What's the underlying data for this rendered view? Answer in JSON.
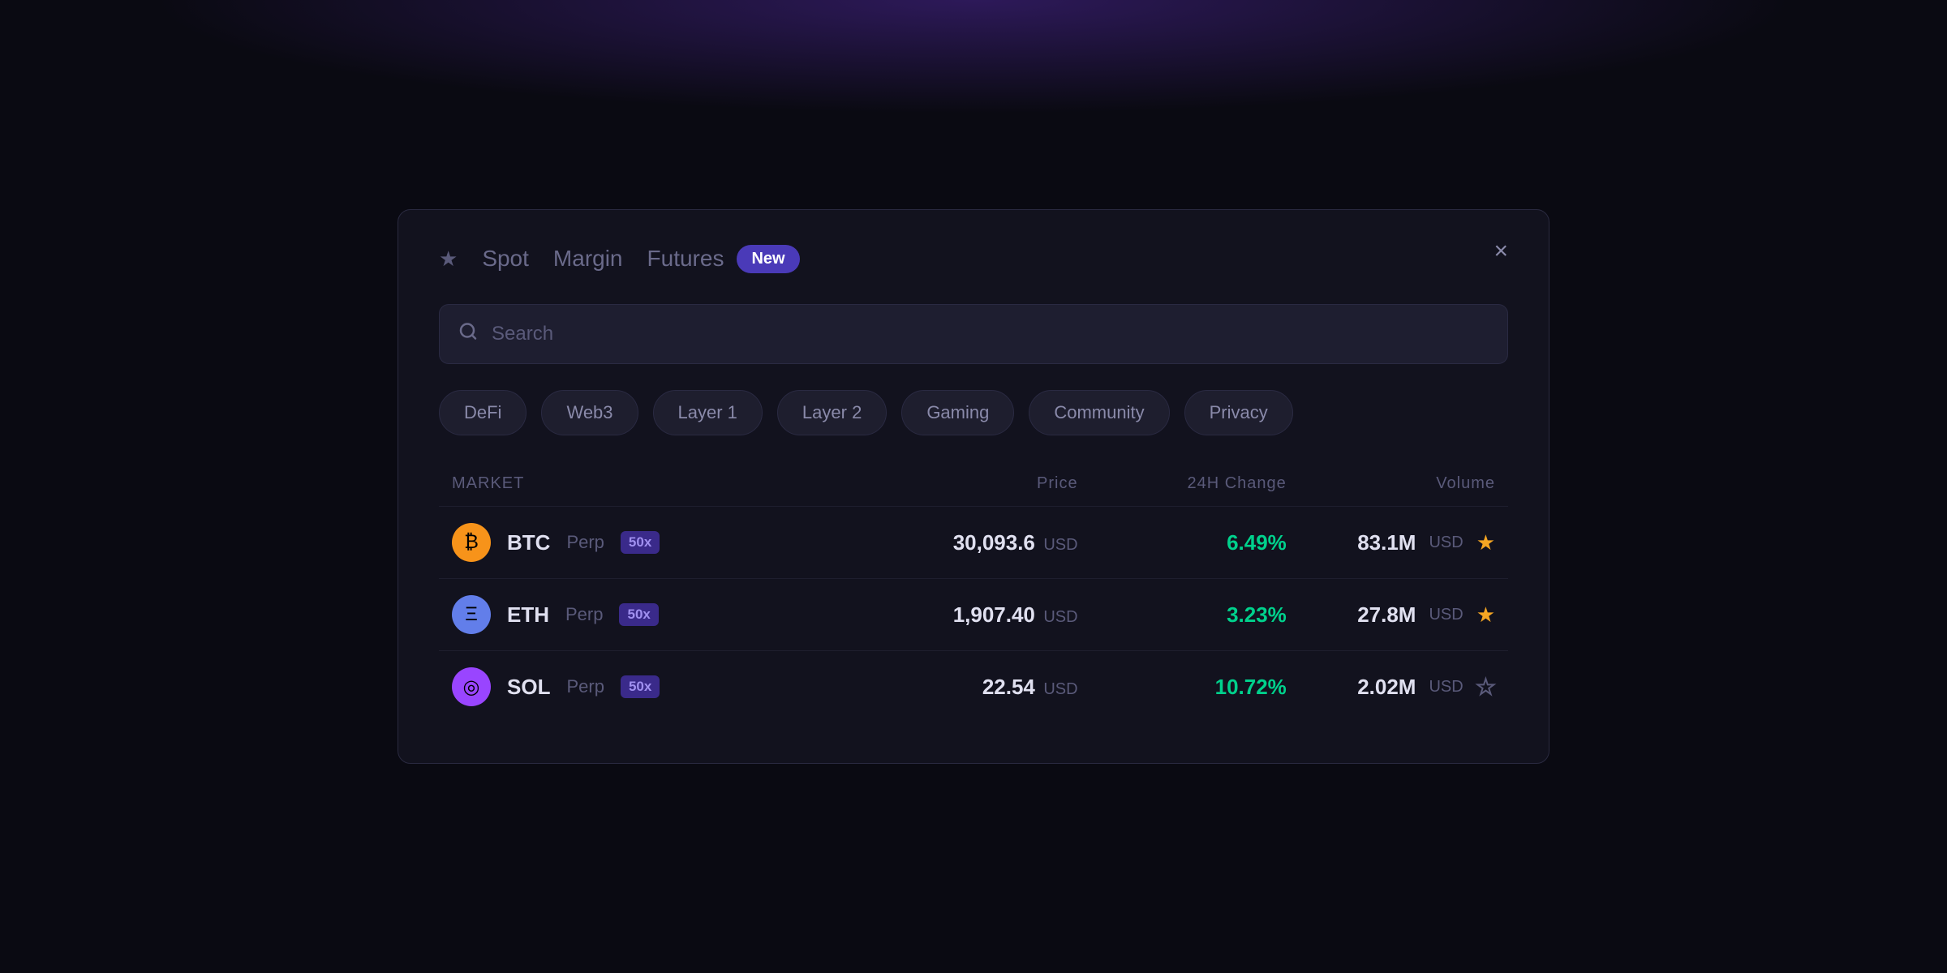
{
  "background": {
    "glow": true
  },
  "modal": {
    "tabs": [
      {
        "id": "spot",
        "label": "Spot"
      },
      {
        "id": "margin",
        "label": "Margin"
      },
      {
        "id": "futures",
        "label": "Futures"
      }
    ],
    "new_badge": "New",
    "close_label": "×",
    "search": {
      "placeholder": "Search"
    },
    "categories": [
      {
        "id": "defi",
        "label": "DeFi"
      },
      {
        "id": "web3",
        "label": "Web3"
      },
      {
        "id": "layer1",
        "label": "Layer 1"
      },
      {
        "id": "layer2",
        "label": "Layer 2"
      },
      {
        "id": "gaming",
        "label": "Gaming"
      },
      {
        "id": "community",
        "label": "Community"
      },
      {
        "id": "privacy",
        "label": "Privacy"
      }
    ],
    "table": {
      "headers": [
        {
          "id": "market",
          "label": "MARKET",
          "align": "left"
        },
        {
          "id": "price",
          "label": "Price",
          "align": "right"
        },
        {
          "id": "change",
          "label": "24H Change",
          "align": "right"
        },
        {
          "id": "volume",
          "label": "Volume",
          "align": "right"
        }
      ],
      "rows": [
        {
          "id": "btc",
          "coin": "BTC",
          "type": "Perp",
          "leverage": "50x",
          "icon_type": "btc",
          "icon_symbol": "₿",
          "price": "30,093.6",
          "price_currency": "USD",
          "change": "6.49%",
          "change_type": "positive",
          "volume": "83.1M",
          "volume_currency": "USD",
          "starred": true
        },
        {
          "id": "eth",
          "coin": "ETH",
          "type": "Perp",
          "leverage": "50x",
          "icon_type": "eth",
          "icon_symbol": "Ξ",
          "price": "1,907.40",
          "price_currency": "USD",
          "change": "3.23%",
          "change_type": "positive",
          "volume": "27.8M",
          "volume_currency": "USD",
          "starred": true
        },
        {
          "id": "sol",
          "coin": "SOL",
          "type": "Perp",
          "leverage": "50x",
          "icon_type": "sol",
          "icon_symbol": "◎",
          "price": "22.54",
          "price_currency": "USD",
          "change": "10.72%",
          "change_type": "positive",
          "volume": "2.02M",
          "volume_currency": "USD",
          "starred": false
        }
      ]
    }
  }
}
